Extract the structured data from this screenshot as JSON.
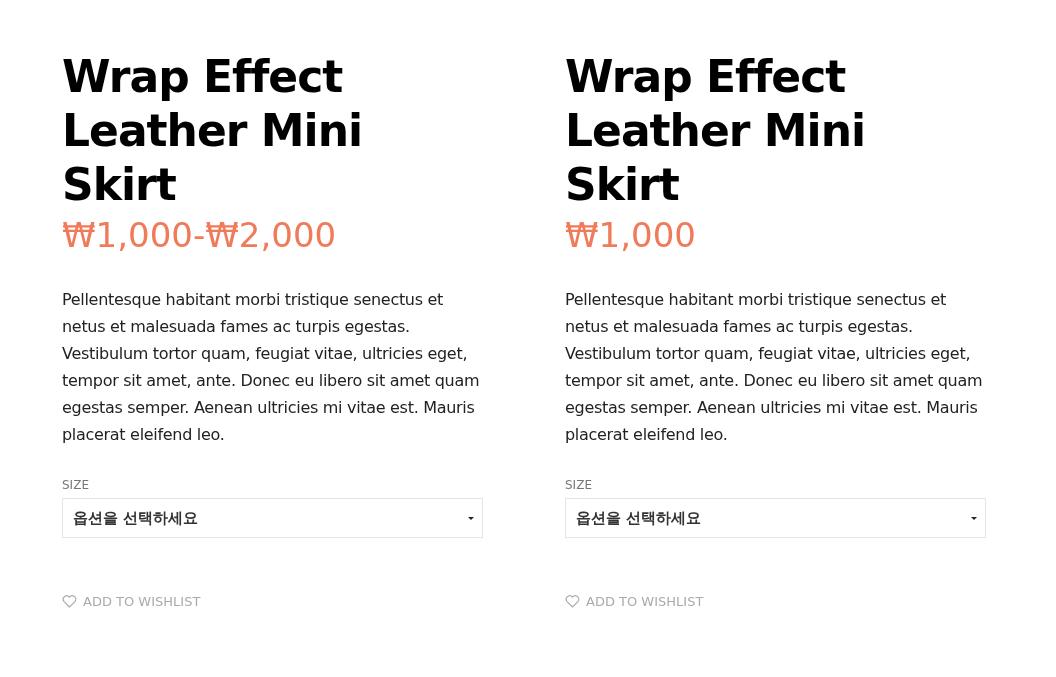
{
  "products": [
    {
      "title": "Wrap Effect Leather Mini Skirt",
      "price": "₩1,000-₩2,000",
      "description": "Pellentesque habitant morbi tristique senectus et netus et malesuada fames ac turpis egestas. Vestibulum tortor quam, feugiat vitae, ultricies eget, tempor sit amet, ante. Donec eu libero sit amet quam egestas semper. Aenean ultricies mi vitae est. Mauris placerat eleifend leo.",
      "option_label": "SIZE",
      "option_select": "옵션을 선택하세요",
      "wishlist": "ADD TO WISHLIST"
    },
    {
      "title": "Wrap Effect Leather Mini Skirt",
      "price": "₩1,000",
      "description": "Pellentesque habitant morbi tristique senectus et netus et malesuada fames ac turpis egestas. Vestibulum tortor quam, feugiat vitae, ultricies eget, tempor sit amet, ante. Donec eu libero sit amet quam egestas semper. Aenean ultricies mi vitae est. Mauris placerat eleifend leo.",
      "option_label": "SIZE",
      "option_select": "옵션을 선택하세요",
      "wishlist": "ADD TO WISHLIST"
    }
  ]
}
